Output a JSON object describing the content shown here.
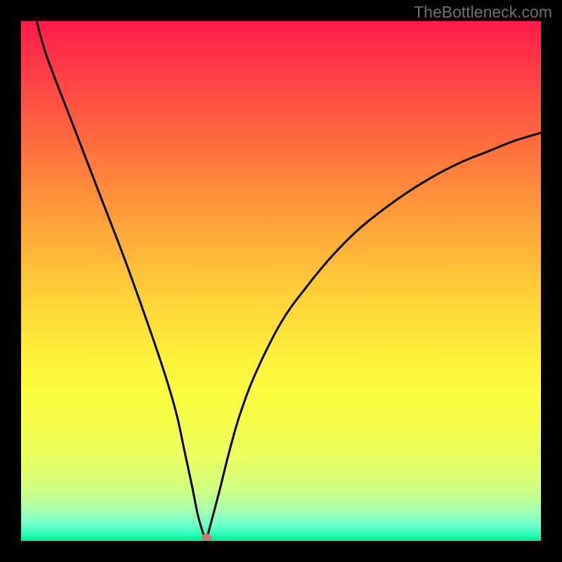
{
  "watermark": "TheBottleneck.com",
  "chart_data": {
    "type": "line",
    "title": "",
    "xlabel": "",
    "ylabel": "",
    "xlim": [
      0,
      100
    ],
    "ylim": [
      0,
      100
    ],
    "grid": false,
    "series": [
      {
        "name": "curve",
        "x": [
          3,
          5,
          10,
          15,
          20,
          25,
          28,
          30,
          31.5,
          33,
          34,
          35,
          35.5,
          36,
          38,
          40,
          42,
          45,
          50,
          55,
          60,
          65,
          70,
          75,
          80,
          85,
          90,
          95,
          100
        ],
        "values": [
          100,
          93,
          80,
          67,
          54,
          40,
          31,
          24,
          17,
          10,
          5,
          1.5,
          0,
          1.5,
          9,
          17,
          24,
          32,
          42,
          49,
          55,
          60,
          64,
          67.5,
          70.5,
          73,
          75,
          77,
          78.5
        ]
      }
    ],
    "marker": {
      "x": 35.7,
      "y": 0.7,
      "color": "#c87a6d"
    },
    "background": "rainbow-vertical-gradient"
  }
}
